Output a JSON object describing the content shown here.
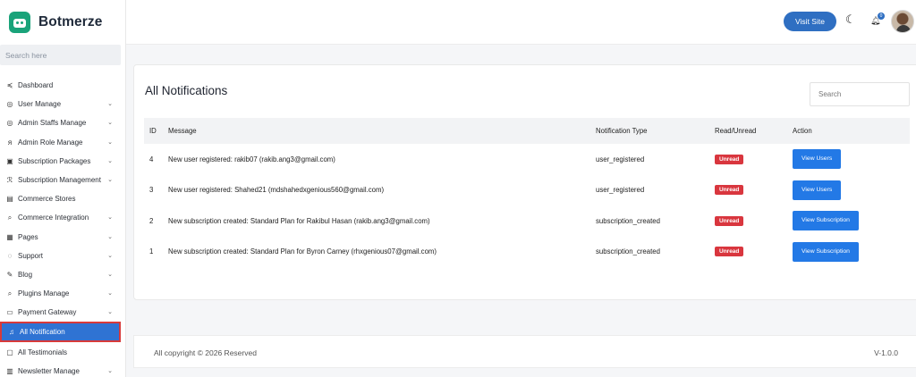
{
  "brand": {
    "name": "Botmerze"
  },
  "sidebar": {
    "search_placeholder": "Search here",
    "items": [
      {
        "label": "Dashboard",
        "icon": "≼",
        "chevron": false
      },
      {
        "label": "User Manage",
        "icon": "◎",
        "chevron": true
      },
      {
        "label": "Admin Staffs Manage",
        "icon": "◎",
        "chevron": true
      },
      {
        "label": "Admin Role Manage",
        "icon": "ᴙ",
        "chevron": true
      },
      {
        "label": "Subscription Packages",
        "icon": "▣",
        "chevron": true
      },
      {
        "label": "Subscription Management",
        "icon": "ℛ",
        "chevron": true
      },
      {
        "label": "Commerce Stores",
        "icon": "▤",
        "chevron": false
      },
      {
        "label": "Commerce Integration",
        "icon": "⌕",
        "chevron": true
      },
      {
        "label": "Pages",
        "icon": "▦",
        "chevron": true
      },
      {
        "label": "Support",
        "icon": "◌",
        "chevron": true
      },
      {
        "label": "Blog",
        "icon": "✎",
        "chevron": true
      },
      {
        "label": "Plugins Manage",
        "icon": "⌕",
        "chevron": true
      },
      {
        "label": "Payment Gateway",
        "icon": "▭",
        "chevron": true
      },
      {
        "label": "All Notification",
        "icon": "♫",
        "chevron": false,
        "active": true
      },
      {
        "label": "All Testimonials",
        "icon": "▢",
        "chevron": false
      },
      {
        "label": "Newsletter Manage",
        "icon": "▥",
        "chevron": true
      }
    ]
  },
  "topbar": {
    "visit_site": "Visit Site",
    "notification_count": "0"
  },
  "main": {
    "title": "All Notifications",
    "search_placeholder": "Search",
    "columns": [
      "ID",
      "Message",
      "Notification Type",
      "Read/Unread",
      "Action"
    ],
    "rows": [
      {
        "id": "4",
        "message": "New user registered: rakib07 (rakib.ang3@gmail.com)",
        "type": "user_registered",
        "status": "Unread",
        "action": "View Users"
      },
      {
        "id": "3",
        "message": "New user registered: Shahed21 (mdshahedxgenious560@gmail.com)",
        "type": "user_registered",
        "status": "Unread",
        "action": "View Users"
      },
      {
        "id": "2",
        "message": "New subscription created: Standard Plan for Rakibul Hasan (rakib.ang3@gmail.com)",
        "type": "subscription_created",
        "status": "Unread",
        "action": "View Subscription"
      },
      {
        "id": "1",
        "message": "New subscription created: Standard Plan for Byron Carney (rhxgenious07@gmail.com)",
        "type": "subscription_created",
        "status": "Unread",
        "action": "View Subscription"
      }
    ]
  },
  "footer": {
    "copyright": "All copyright © 2026 Reserved",
    "version": "V-1.0.0"
  },
  "colors": {
    "brand": "#1aa37a",
    "primary": "#2f6fc2",
    "button": "#2379e6",
    "unread": "#d9363e",
    "active_outline": "#d83a3a"
  }
}
